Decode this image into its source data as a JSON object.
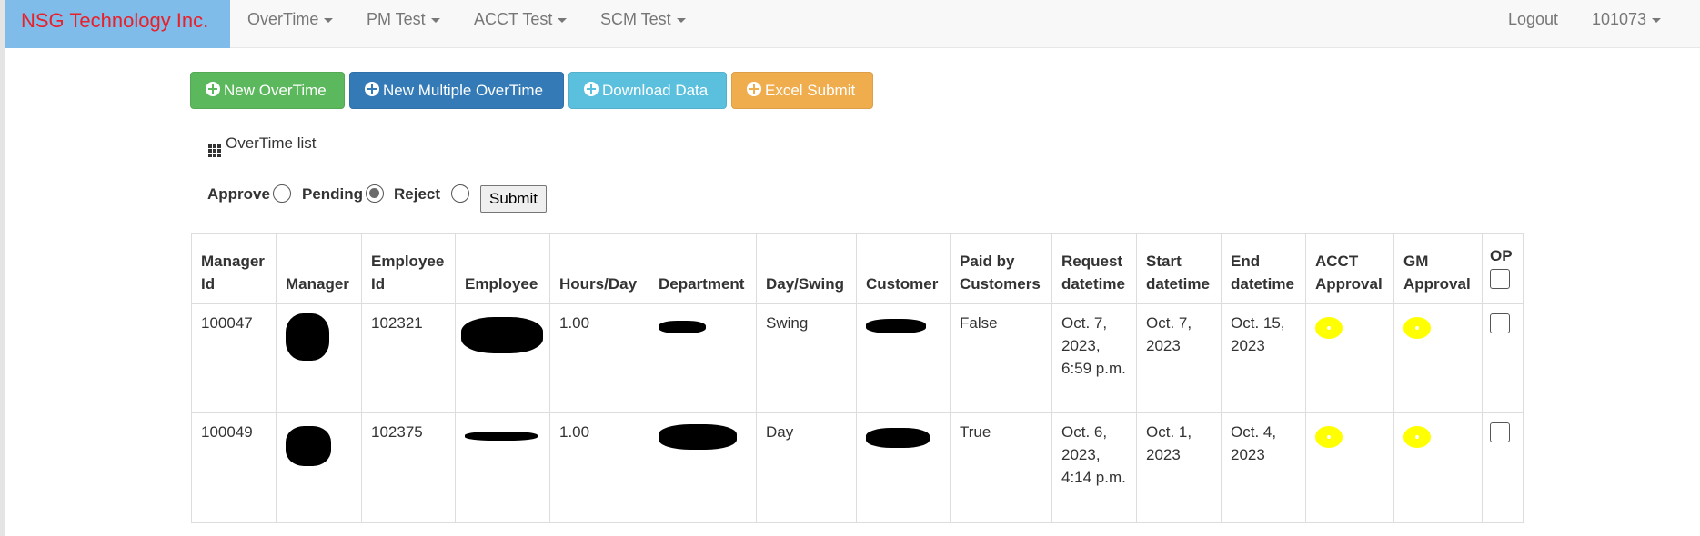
{
  "navbar": {
    "brand": "NSG Technology Inc.",
    "menus": [
      "OverTime",
      "PM Test",
      "ACCT Test",
      "SCM Test"
    ],
    "logout": "Logout",
    "user": "101073"
  },
  "toolbar": {
    "new_overtime": "New OverTime",
    "new_multiple_overtime": "New Multiple OverTime",
    "download_data": "Download Data",
    "excel_submit": "Excel Submit"
  },
  "list_title": "OverTime list",
  "filter": {
    "approve": "Approve",
    "pending": "Pending",
    "reject": "Reject",
    "selected": "Pending",
    "submit": "Submit"
  },
  "table": {
    "headers": {
      "manager_id": "Manager Id",
      "manager": "Manager",
      "employee_id": "Employee Id",
      "employee": "Employee",
      "hours_day": "Hours/Day",
      "department": "Department",
      "day_swing": "Day/Swing",
      "customer": "Customer",
      "paid_by_customers": "Paid by Customers",
      "request_datetime": "Request datetime",
      "start_datetime": "Start datetime",
      "end_datetime": "End datetime",
      "acct_approval": "ACCT Approval",
      "gm_approval": "GM Approval",
      "op": "OP"
    },
    "rows": [
      {
        "manager_id": "100047",
        "employee_id": "102321",
        "hours_day": "1.00",
        "day_swing": "Swing",
        "paid_by_customers": "False",
        "request_datetime": "Oct. 7, 2023, 6:59 p.m.",
        "start_datetime": "Oct. 7, 2023",
        "end_datetime": "Oct. 15, 2023"
      },
      {
        "manager_id": "100049",
        "employee_id": "102375",
        "hours_day": "1.00",
        "day_swing": "Day",
        "paid_by_customers": "True",
        "request_datetime": "Oct. 6, 2023, 4:14 p.m.",
        "start_datetime": "Oct. 1, 2023",
        "end_datetime": "Oct. 4, 2023"
      }
    ]
  },
  "icons": {
    "approval": "eye-icon"
  },
  "colors": {
    "brand_bg": "#7fbcea",
    "brand_text": "#e8202a",
    "green": "#5cb85c",
    "blue": "#337ab7",
    "cyan": "#5bc0de",
    "orange": "#f0ad4e",
    "eye": "#ffff00"
  }
}
